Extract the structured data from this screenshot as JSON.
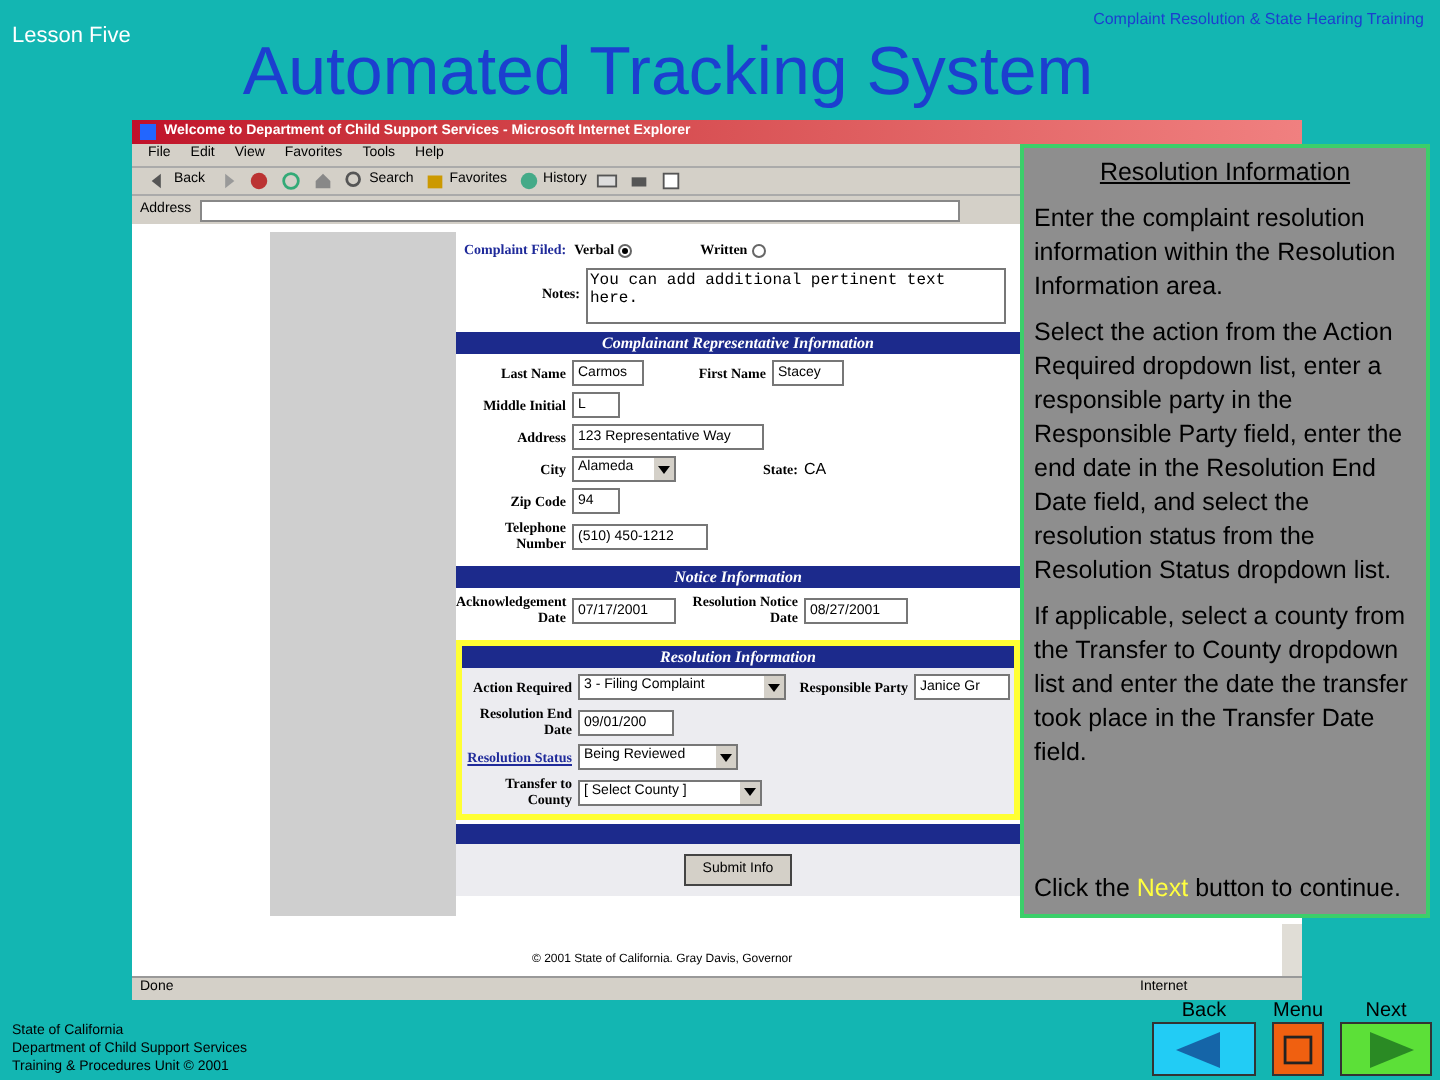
{
  "slide": {
    "lesson": "Lesson Five",
    "course": "Complaint Resolution & State Hearing Training",
    "title": "Automated Tracking System"
  },
  "browser": {
    "title": "Welcome to Department of Child Support Services - Microsoft Internet Explorer",
    "menu": [
      "File",
      "Edit",
      "View",
      "Favorites",
      "Tools",
      "Help"
    ],
    "toolbar": [
      {
        "kind": "back",
        "label": "Back"
      },
      {
        "kind": "forward"
      },
      {
        "kind": "stop"
      },
      {
        "kind": "refresh"
      },
      {
        "kind": "home"
      },
      {
        "kind": "search",
        "label": "Search"
      },
      {
        "kind": "favorites",
        "label": "Favorites"
      },
      {
        "kind": "history",
        "label": "History"
      },
      {
        "kind": "mail"
      },
      {
        "kind": "print"
      },
      {
        "kind": "edit"
      }
    ],
    "address_label": "Address",
    "status": "Done",
    "zone": "Internet",
    "copyright": "© 2001 State of California. Gray Davis, Governor"
  },
  "form": {
    "complaint_filed": {
      "label": "Complaint Filed:",
      "options": [
        {
          "label": "Verbal",
          "selected": true
        },
        {
          "label": "Written",
          "selected": false
        }
      ]
    },
    "notes": {
      "label": "Notes:",
      "value": "You can add additional pertinent text here."
    },
    "sections": [
      {
        "heading": "Complainant Representative Information",
        "highlighted": false,
        "rows": [
          [
            {
              "label": "Last Name",
              "value": "Carmos",
              "kind": "text",
              "linked": false
            },
            {
              "label": "First Name",
              "value": "Stacey",
              "kind": "text",
              "linked": false
            }
          ],
          [
            {
              "label": "Middle Initial",
              "value": "L",
              "kind": "text",
              "linked": false
            }
          ],
          [
            {
              "label": "Address",
              "value": "123 Representative Way",
              "kind": "text",
              "linked": false
            }
          ],
          [
            {
              "label": "City",
              "value": "Alameda",
              "kind": "select",
              "linked": false
            },
            {
              "label": "State:",
              "value": "CA",
              "kind": "static",
              "linked": false
            }
          ],
          [
            {
              "label": "Zip Code",
              "value": "94",
              "kind": "text",
              "linked": false
            }
          ],
          [
            {
              "label": "Telephone Number",
              "value": "(510) 450-1212",
              "kind": "text",
              "linked": false
            }
          ]
        ]
      },
      {
        "heading": "Notice Information",
        "highlighted": false,
        "rows": [
          [
            {
              "label": "Acknowledgement Date",
              "value": "07/17/2001",
              "kind": "text",
              "linked": false
            },
            {
              "label": "Resolution Notice Date",
              "value": "08/27/2001",
              "kind": "text",
              "linked": false
            }
          ]
        ]
      },
      {
        "heading": "Resolution Information",
        "highlighted": true,
        "rows": [
          [
            {
              "label": "Action Required",
              "value": "3 - Filing Complaint",
              "kind": "select",
              "linked": false
            },
            {
              "label": "Responsible Party",
              "value": "Janice Gr",
              "kind": "text",
              "linked": false
            }
          ],
          [
            {
              "label": "Resolution End Date",
              "value": "09/01/200",
              "kind": "text",
              "linked": false
            }
          ],
          [
            {
              "label": "Resolution Status",
              "value": "Being Reviewed",
              "kind": "select",
              "linked": true
            }
          ],
          [
            {
              "label": "Transfer to County",
              "value": "[ Select County ]",
              "kind": "select",
              "linked": false
            }
          ]
        ]
      }
    ],
    "submit": "Submit Info"
  },
  "callout": {
    "heading": "Resolution Information",
    "paragraphs": [
      [
        {
          "kind": "plain",
          "text": "Enter the complaint resolution information within the Resolution Information area."
        }
      ],
      [
        {
          "kind": "plain",
          "text": "Select the action from the Action Required dropdown list, enter a responsible party in the Responsible Party field, enter the end date in the Resolution End Date field, and select the resolution status from the Resolution Status dropdown list."
        }
      ],
      [
        {
          "kind": "plain",
          "text": "If applicable, select a county from the Transfer to County dropdown list and enter the date the transfer took place in the Transfer Date field."
        }
      ],
      [
        {
          "kind": "plain",
          "text": "Click the "
        },
        {
          "kind": "highlight",
          "text": "Next"
        },
        {
          "kind": "plain",
          "text": " button to continue."
        }
      ]
    ]
  },
  "footer": {
    "lines": [
      "State of California",
      "Department of Child Support Services",
      "Training & Procedures Unit  © 2001"
    ]
  },
  "nav": [
    {
      "kind": "back",
      "label": "Back"
    },
    {
      "kind": "menu",
      "label": "Menu"
    },
    {
      "kind": "next",
      "label": "Next"
    }
  ]
}
